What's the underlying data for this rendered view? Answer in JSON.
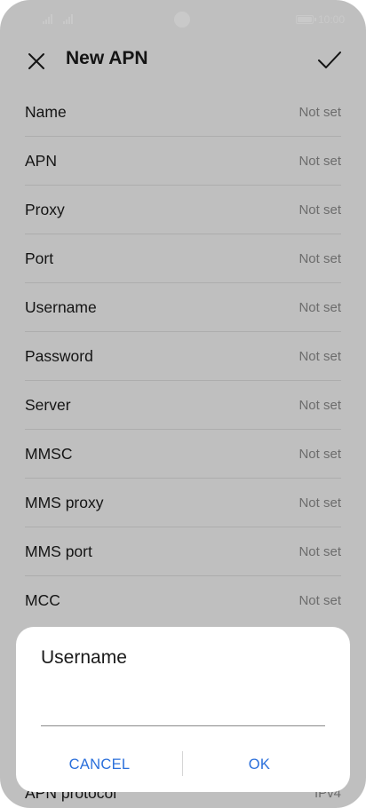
{
  "status_bar": {
    "time": "10:00",
    "icons": [
      "signal-icon",
      "signal-icon",
      "camera-cutout",
      "battery-icon"
    ]
  },
  "header": {
    "title": "New APN",
    "close_icon": "close-icon",
    "confirm_icon": "check-icon"
  },
  "apn_fields": [
    {
      "label": "Name",
      "value": "Not set"
    },
    {
      "label": "APN",
      "value": "Not set"
    },
    {
      "label": "Proxy",
      "value": "Not set"
    },
    {
      "label": "Port",
      "value": "Not set"
    },
    {
      "label": "Username",
      "value": "Not set"
    },
    {
      "label": "Password",
      "value": "Not set"
    },
    {
      "label": "Server",
      "value": "Not set"
    },
    {
      "label": "MMSC",
      "value": "Not set"
    },
    {
      "label": "MMS proxy",
      "value": "Not set"
    },
    {
      "label": "MMS port",
      "value": "Not set"
    },
    {
      "label": "MCC",
      "value": "Not set"
    }
  ],
  "peek_field": {
    "label": "APN protocol",
    "value": "IPv4"
  },
  "dialog": {
    "title": "Username",
    "input_value": "",
    "cancel_label": "CANCEL",
    "ok_label": "OK"
  },
  "colors": {
    "accent": "#2a6fdb",
    "background": "#f3f3f3",
    "secondary_text": "#8a8a8a"
  }
}
